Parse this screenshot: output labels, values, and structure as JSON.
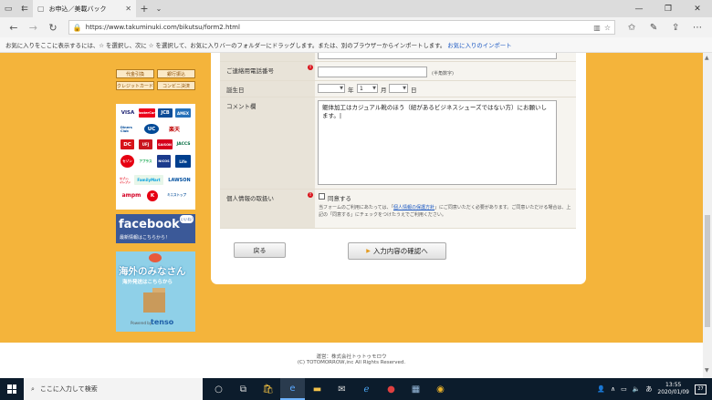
{
  "browser": {
    "tab_title": "お申込／美載バック",
    "url": "https://www.takuminuki.com/bikutsu/form2.html",
    "favorites_bar_text": "お気に入りをここに表示するには、☆ を選択し、次に ☆ を選択して、お気に入りバーのフォルダーにドラッグします。または、別のブラウザーからインポートします。",
    "favorites_link": "お気に入りのインポート"
  },
  "sidebar": {
    "payment_buttons": [
      "代金引換",
      "銀行振込",
      "クレジットカード",
      "コンビニ決済"
    ],
    "card_logos": [
      "VISA",
      "MasterCard",
      "JCB",
      "AMEX",
      "Diners Club",
      "UC",
      "楽天",
      "DC",
      "UFJ",
      "SAISON",
      "JACCS",
      "セゾン",
      "アプラス",
      "NICOS",
      "Life",
      "セブン-イレブン",
      "FamilyMart",
      "LAWSON",
      "ampm",
      "K",
      "ミニストップ"
    ],
    "facebook_title": "facebook",
    "facebook_sub": "最新情報はこちらから！",
    "facebook_bubble": "いいね!",
    "tenso_title": "海外のみなさん",
    "tenso_sub": "海外発送はこちらから",
    "tenso_powered": "Powered by",
    "tenso_brand": "tenso"
  },
  "form": {
    "phone_label": "ご連絡用電話番号",
    "phone_value": "",
    "phone_note": "(半角数字)",
    "birthday_label": "誕生日",
    "birthday_year_unit": "年",
    "birthday_month_value": "1",
    "birthday_month_unit": "月",
    "birthday_day_unit": "日",
    "comment_label": "コメント欄",
    "comment_value": "躯体加工はカジュアル靴のほう（紐があるビジネスシューズではない方）にお願いします。|",
    "privacy_label": "個人情報の取扱い",
    "agree_label": "同意する",
    "privacy_text_1": "当フォームのご利用にあたっては、「",
    "privacy_link": "個人情報の保護方針",
    "privacy_text_2": "」にご同意いただく必要があります。ご同意いただける場合は、上記の「同意する」にチェックをつけたうえでご利用ください。",
    "back_button": "戻る",
    "confirm_button": "入力内容の確認へ"
  },
  "footer": {
    "operator": "運営：株式会社トゥトゥモロウ",
    "copyright": "(C) TOTOMORROW,inc All Rights Reserved."
  },
  "taskbar": {
    "search_placeholder": "ここに入力して検索",
    "time": "13:55",
    "date": "2020/01/09",
    "ime": "あ",
    "notifications": "27"
  }
}
